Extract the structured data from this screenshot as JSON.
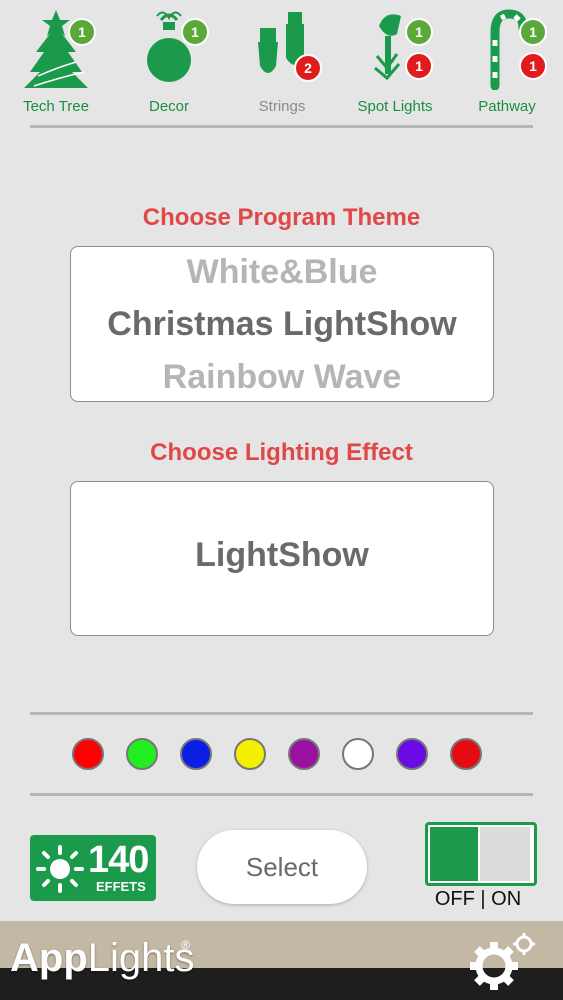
{
  "nav": {
    "items": [
      {
        "label": "Tech Tree",
        "badges": [
          {
            "count": "1",
            "color": "green"
          }
        ]
      },
      {
        "label": "Decor",
        "badges": [
          {
            "count": "1",
            "color": "green"
          }
        ]
      },
      {
        "label": "Strings",
        "badges": [
          {
            "count": "2",
            "color": "red"
          }
        ]
      },
      {
        "label": "Spot Lights",
        "badges": [
          {
            "count": "1",
            "color": "green"
          },
          {
            "count": "1",
            "color": "red"
          }
        ]
      },
      {
        "label": "Pathway",
        "badges": [
          {
            "count": "1",
            "color": "green"
          },
          {
            "count": "1",
            "color": "red"
          }
        ]
      }
    ]
  },
  "theme": {
    "heading": "Choose Program Theme",
    "options": [
      "White&Blue",
      "Christmas LightShow",
      "Rainbow Wave"
    ],
    "selected": "Christmas LightShow"
  },
  "effect": {
    "heading": "Choose Lighting Effect",
    "value": "LightShow"
  },
  "colors": [
    "#ff0000",
    "#22ee22",
    "#0b1ee6",
    "#f5f000",
    "#9a10a0",
    "#ffffff",
    "#6a0be6",
    "#e60b12"
  ],
  "effects_badge": {
    "number": "140",
    "word": "EFFETS"
  },
  "select_button": {
    "label": "Select"
  },
  "power": {
    "label": "OFF | ON",
    "state": "on"
  },
  "brand": {
    "bold": "App",
    "light": "Lights",
    "reg": "®"
  },
  "icons": {
    "tree": "christmas-tree-icon",
    "decor": "ornament-icon",
    "strings": "string-lights-icon",
    "spot": "spot-light-icon",
    "pathway": "candy-cane-icon",
    "sun": "sun-icon",
    "gear": "settings-gear-icon"
  },
  "accent": {
    "green": "#1a9a4a",
    "red_heading": "#e04848"
  }
}
